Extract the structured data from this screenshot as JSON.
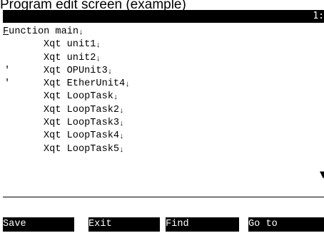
{
  "caption": "Program edit screen (example)",
  "titlebar": {
    "line_position": "1:"
  },
  "code_lines": [
    {
      "marker": "",
      "first": "F",
      "rest": "unction main",
      "eol": "↓"
    },
    {
      "marker": "",
      "first": "",
      "rest": "Xqt unit1",
      "eol": "↓"
    },
    {
      "marker": "",
      "first": "",
      "rest": "Xqt unit2",
      "eol": "↓"
    },
    {
      "marker": "'",
      "first": "",
      "rest": "Xqt OPUnit3",
      "eol": "↓"
    },
    {
      "marker": "'",
      "first": "",
      "rest": "Xqt EtherUnit4",
      "eol": "↓"
    },
    {
      "marker": "",
      "first": "",
      "rest": "Xqt LoopTask",
      "eol": "↓"
    },
    {
      "marker": "",
      "first": "",
      "rest": "Xqt LoopTask2",
      "eol": "↓"
    },
    {
      "marker": "",
      "first": "",
      "rest": "Xqt LoopTask3",
      "eol": "↓"
    },
    {
      "marker": "",
      "first": "",
      "rest": "Xqt LoopTask4",
      "eol": "↓"
    },
    {
      "marker": "",
      "first": "",
      "rest": "Xqt LoopTask5",
      "eol": "↓"
    }
  ],
  "scroll_indicator": "▼",
  "function_keys": [
    "Save",
    "Exit",
    "Find",
    "Go to"
  ],
  "colors": {
    "bar": "#000000",
    "bar_text": "#ffffff",
    "background": "#ffffff"
  }
}
